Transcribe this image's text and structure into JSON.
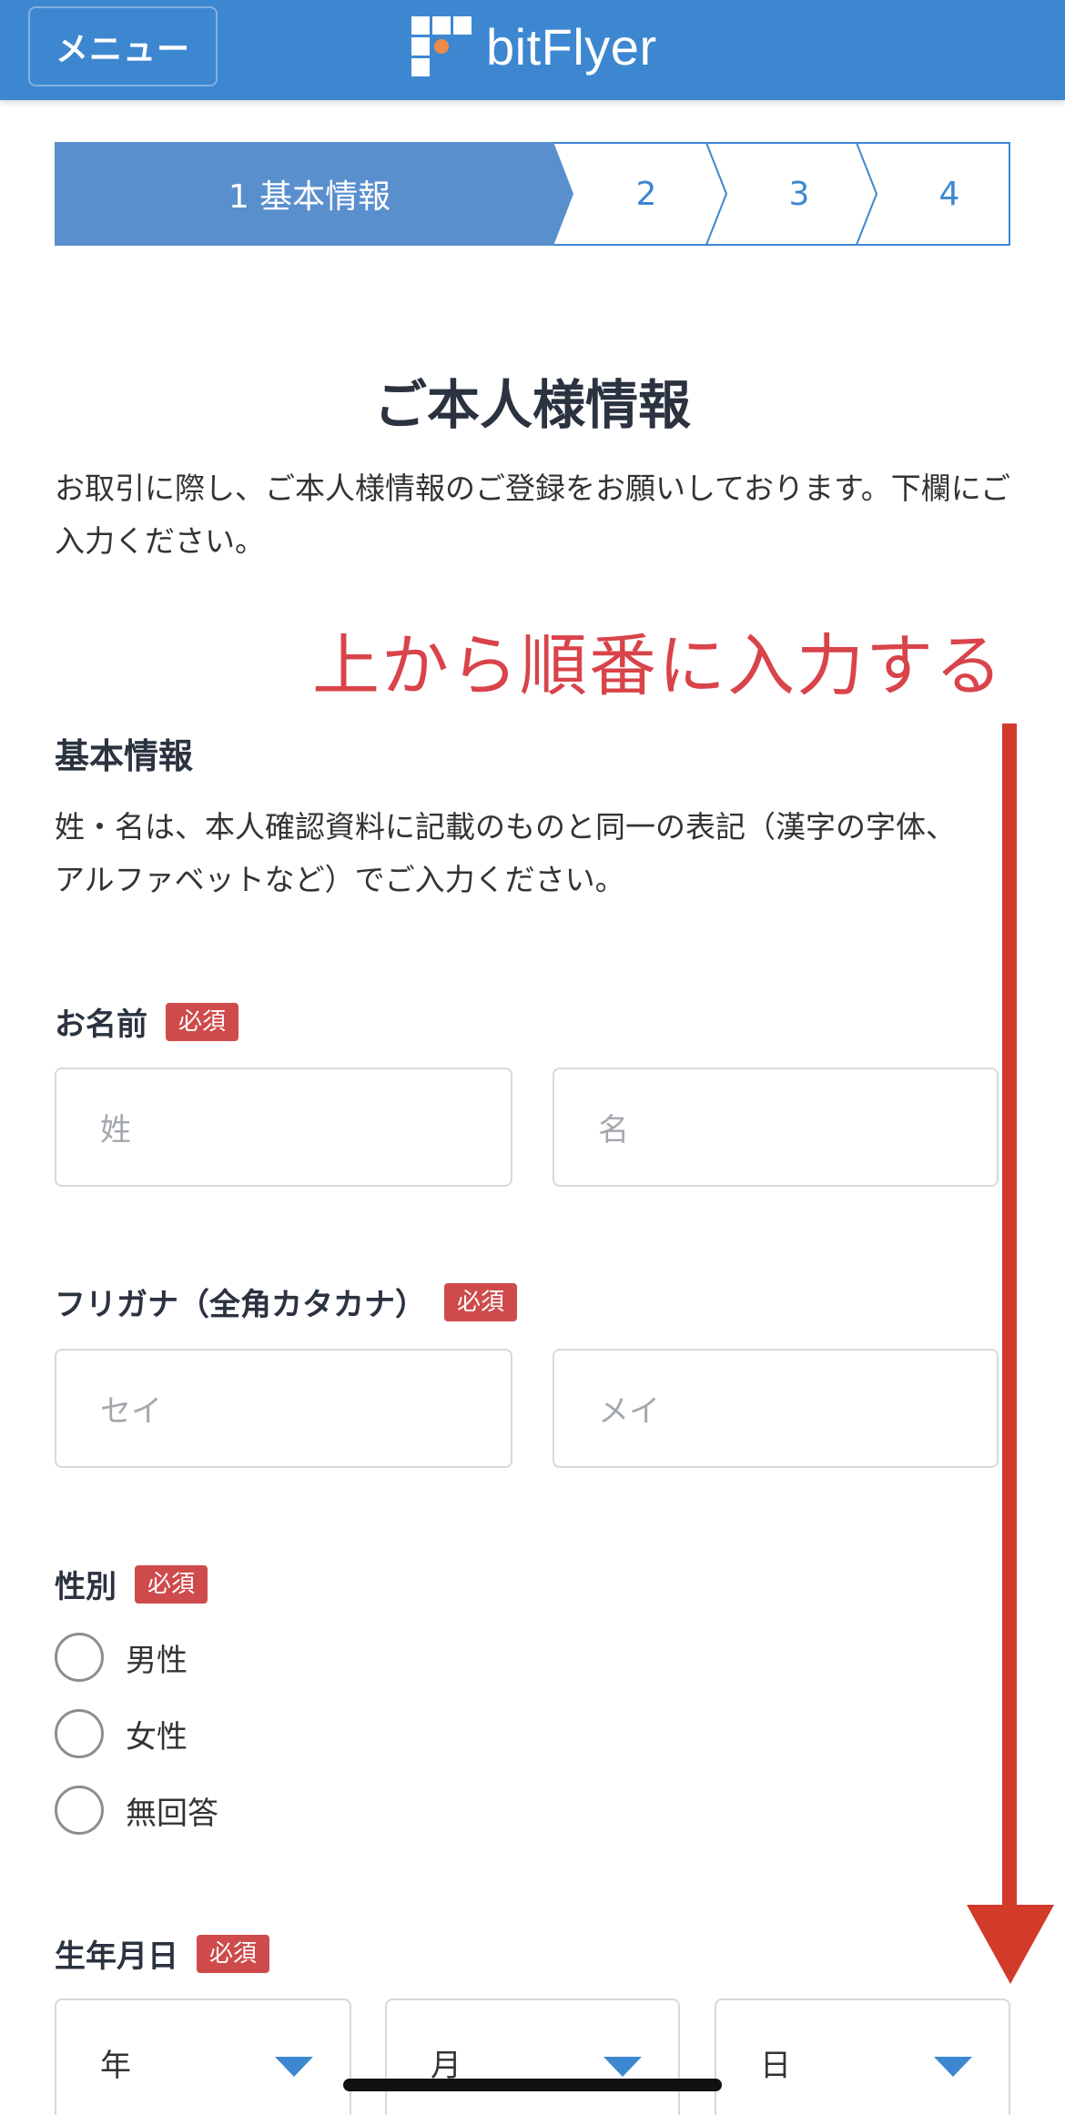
{
  "header": {
    "menu_label": "メニュー",
    "logo_text": "bitFlyer",
    "logo_icon": "bitflyer-logo-icon"
  },
  "stepper": {
    "steps": [
      {
        "label": "1 基本情報",
        "active": true
      },
      {
        "label": "2",
        "active": false
      },
      {
        "label": "3",
        "active": false
      },
      {
        "label": "4",
        "active": false
      }
    ]
  },
  "page": {
    "title": "ご本人様情報",
    "intro": "お取引に際し、ご本人様情報のご登録をお願いしております。下欄にご入力ください。"
  },
  "annotation": {
    "text": "上から順番に入力する",
    "color": "#d9434a",
    "icon": "down-arrow-icon"
  },
  "basic_info": {
    "heading": "基本情報",
    "description": "姓・名は、本人確認資料に記載のものと同一の表記（漢字の字体、アルファベットなど）でご入力ください。"
  },
  "required_label": "必須",
  "name": {
    "label": "お名前",
    "last_placeholder": "姓",
    "first_placeholder": "名"
  },
  "kana": {
    "label": "フリガナ（全角カタカナ）",
    "last_placeholder": "セイ",
    "first_placeholder": "メイ"
  },
  "gender": {
    "label": "性別",
    "options": [
      "男性",
      "女性",
      "無回答"
    ]
  },
  "birthdate": {
    "label": "生年月日",
    "year": "年",
    "month": "月",
    "day": "日"
  },
  "colors": {
    "brand_blue": "#3d87d1",
    "required_red": "#cf4b4b",
    "arrow_red": "#d23a2a"
  }
}
